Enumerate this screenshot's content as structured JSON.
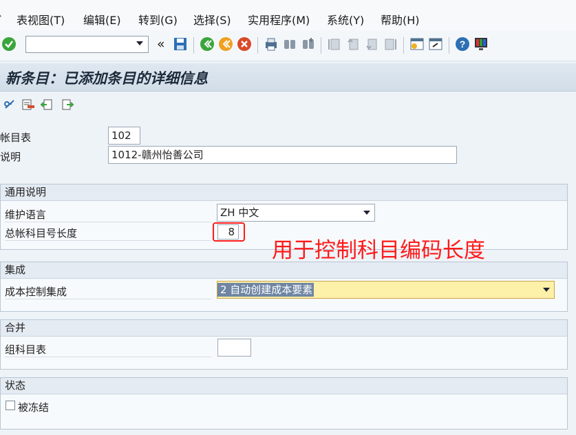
{
  "menubar": {
    "items": [
      "表视图(T)",
      "编辑(E)",
      "转到(G)",
      "选择(S)",
      "实用程序(M)",
      "系统(Y)",
      "帮助(H)"
    ]
  },
  "toolbar": {
    "command_value": "",
    "back_glyph": "«",
    "icons": [
      "check-icon",
      "save-icon",
      "back-icon",
      "exit-icon",
      "cancel-icon",
      "print-icon",
      "find-icon",
      "find-next-icon",
      "first-page-icon",
      "prev-page-icon",
      "next-page-icon",
      "last-page-icon",
      "new-session-icon",
      "shortcut-icon",
      "help-icon",
      "customize-layout-icon"
    ]
  },
  "title": "新条目：已添加条目的详细信息",
  "app_toolbar": {
    "icons": [
      "display-change-icon",
      "delete-icon",
      "previous-entry-icon",
      "next-entry-icon"
    ]
  },
  "header_fields": {
    "chart_label": "帐目表",
    "chart_value": "102",
    "desc_label": "说明",
    "desc_value": "1012-赣州怡善公司"
  },
  "general": {
    "title": "通用说明",
    "lang_label": "维护语言",
    "lang_value": "ZH 中文",
    "length_label": "总帐科目号长度",
    "length_value": "8"
  },
  "integration": {
    "title": "集成",
    "cost_label": "成本控制集成",
    "cost_value": "2 自动创建成本要素"
  },
  "consolidation": {
    "title": "合并",
    "group_label": "组科目表",
    "group_value": ""
  },
  "status": {
    "title": "状态",
    "blocked_label": "被冻结",
    "blocked_checked": false
  },
  "annotation": "用于控制科目编码长度",
  "colors": {
    "annotation": "#ff1a1a",
    "highlight": "#fdf0a8",
    "title_bg": "#d2dde8"
  }
}
